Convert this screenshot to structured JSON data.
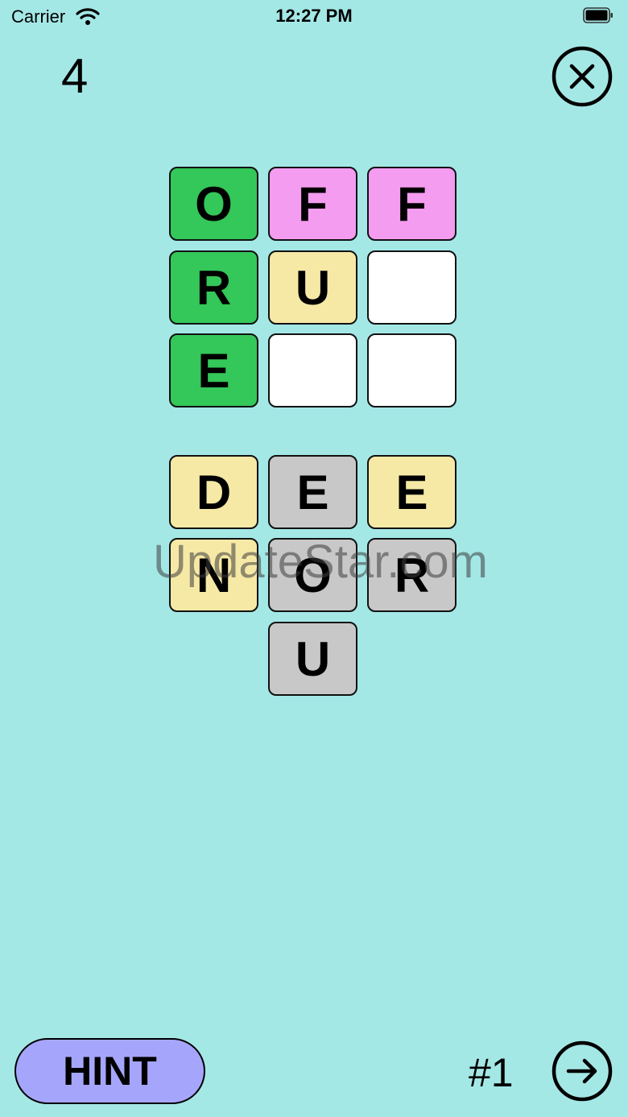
{
  "status_bar": {
    "carrier": "Carrier",
    "time": "12:27 PM",
    "icons": [
      "wifi-icon",
      "battery-icon"
    ]
  },
  "game": {
    "score": "4",
    "close_icon": "close-circle-icon",
    "board": [
      [
        {
          "letter": "O",
          "state": "green"
        },
        {
          "letter": "F",
          "state": "pink"
        },
        {
          "letter": "F",
          "state": "pink"
        }
      ],
      [
        {
          "letter": "R",
          "state": "green"
        },
        {
          "letter": "U",
          "state": "yellow"
        },
        {
          "letter": "",
          "state": "white"
        }
      ],
      [
        {
          "letter": "E",
          "state": "green"
        },
        {
          "letter": "",
          "state": "white"
        },
        {
          "letter": "",
          "state": "white"
        }
      ]
    ],
    "letter_pool": [
      [
        {
          "letter": "D",
          "state": "yellow"
        },
        {
          "letter": "E",
          "state": "gray"
        },
        {
          "letter": "E",
          "state": "yellow"
        }
      ],
      [
        {
          "letter": "N",
          "state": "yellow"
        },
        {
          "letter": "O",
          "state": "gray"
        },
        {
          "letter": "R",
          "state": "gray"
        }
      ],
      [
        {
          "letter": "U",
          "state": "gray"
        }
      ]
    ],
    "watermark": "UpdateStar.com",
    "hint_label": "HINT",
    "level_label": "#1",
    "next_icon": "arrow-right-circle-icon"
  },
  "colors": {
    "background": "#a4e8e6",
    "green": "#34c759",
    "pink": "#f49cf0",
    "yellow": "#f6e9a6",
    "gray": "#c8c8c8",
    "white": "#ffffff",
    "hint_button": "#a5a6fb"
  }
}
